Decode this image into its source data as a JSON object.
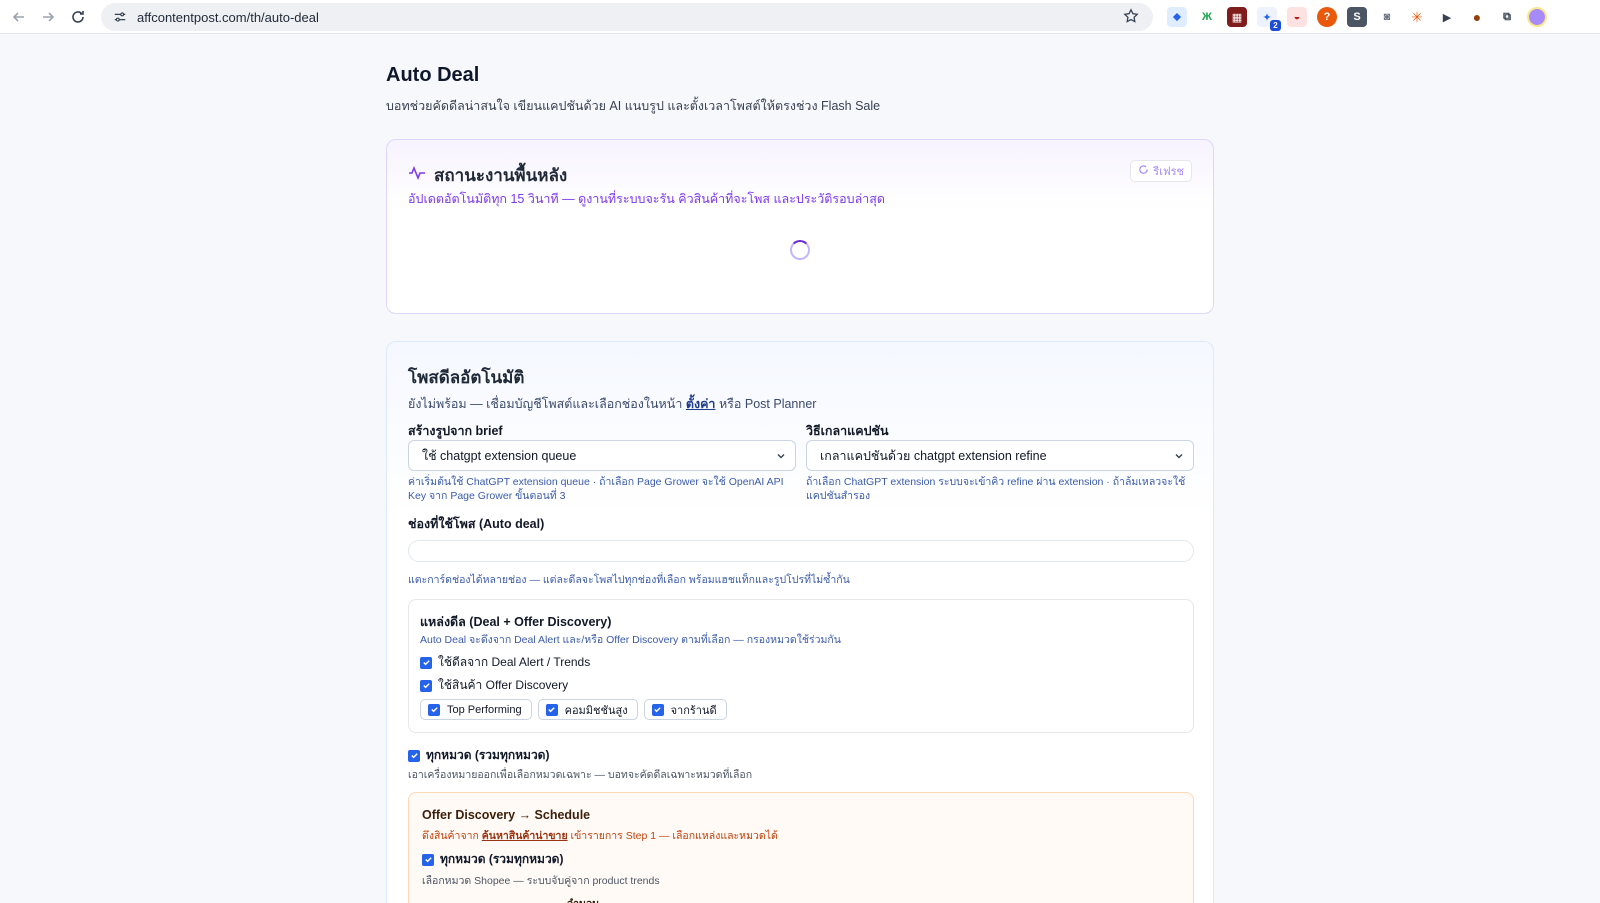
{
  "browser": {
    "url": "affcontentpost.com/th/auto-deal",
    "extension_badge": "2"
  },
  "page": {
    "title": "Auto Deal",
    "subtitle": "บอทช่วยคัดดีลน่าสนใจ เขียนแคปชันด้วย AI แนบรูป และตั้งเวลาโพสต์ให้ตรงช่วง Flash Sale"
  },
  "status": {
    "title": "สถานะงานพื้นหลัง",
    "description": "อัปเดตอัตโนมัติทุก 15 วินาที — ดูงานที่ระบบจะรัน คิวสินค้าที่จะโพส และประวัติรอบล่าสุด",
    "refresh_label": "รีเฟรช"
  },
  "auto_post": {
    "title": "โพสดีลอัตโนมัติ",
    "warning_prefix": "ยังไม่พร้อม — เชื่อมบัญชีโพสต์และเลือกช่องในหน้า",
    "warning_link": "ตั้งค่า",
    "warning_suffix": "หรือ Post Planner",
    "brief": {
      "label": "สร้างรูปจาก brief",
      "selected": "ใช้ chatgpt extension queue",
      "help": "ค่าเริ่มต้นใช้ ChatGPT extension queue · ถ้าเลือก Page Grower จะใช้ OpenAI API Key จาก Page Grower ขั้นตอนที่ 3"
    },
    "caption": {
      "label": "วิธีเกลาแคปชัน",
      "selected": "เกลาแคปชันด้วย chatgpt extension refine",
      "help": "ถ้าเลือก ChatGPT extension ระบบจะเข้าคิว refine ผ่าน extension · ถ้าล้มเหลวจะใช้แคปชันสำรอง"
    },
    "channels": {
      "label": "ช่องที่ใช้โพส (Auto deal)",
      "help": "แตะการ์ดช่องได้หลายช่อง — แต่ละดีลจะโพสไปทุกช่องที่เลือก พร้อมแฮชแท็กและรูปโปรที่ไม่ซ้ำกัน"
    },
    "source": {
      "title": "แหล่งดีล (Deal + Offer Discovery)",
      "description": "Auto Deal จะดึงจาก Deal Alert และ/หรือ Offer Discovery ตามที่เลือก — กรองหมวดใช้ร่วมกัน",
      "deal_alert_label": "ใช้ดีลจาก Deal Alert / Trends",
      "offer_discovery_label": "ใช้สินค้า Offer Discovery",
      "chips": [
        "Top Performing",
        "คอมมิชชันสูง",
        "จากร้านดี"
      ]
    },
    "all_categories": {
      "label": "ทุกหมวด (รวมทุกหมวด)",
      "help": "เอาเครื่องหมายออกเพื่อเลือกหมวดเฉพาะ — บอทจะคัดดีลเฉพาะหมวดที่เลือก"
    },
    "offer_schedule": {
      "title": "Offer Discovery → Schedule",
      "desc_prefix": "ดึงสินค้าจาก",
      "desc_link": "ค้นหาสินค้าน่าขาย",
      "desc_suffix": "เข้ารายการ Step 1 — เลือกแหล่งและหมวดได้",
      "all_label": "ทุกหมวด (รวมทุกหมวด)",
      "help": "เลือกหมวด Shopee — ระบบจับคู่จาก product trends",
      "qty_label": "จำนวน"
    }
  },
  "colors": {
    "accent": "#7c3aed",
    "checkbox": "#2563eb",
    "link": "#1e3a8a",
    "offer_accent": "#c2410c"
  }
}
